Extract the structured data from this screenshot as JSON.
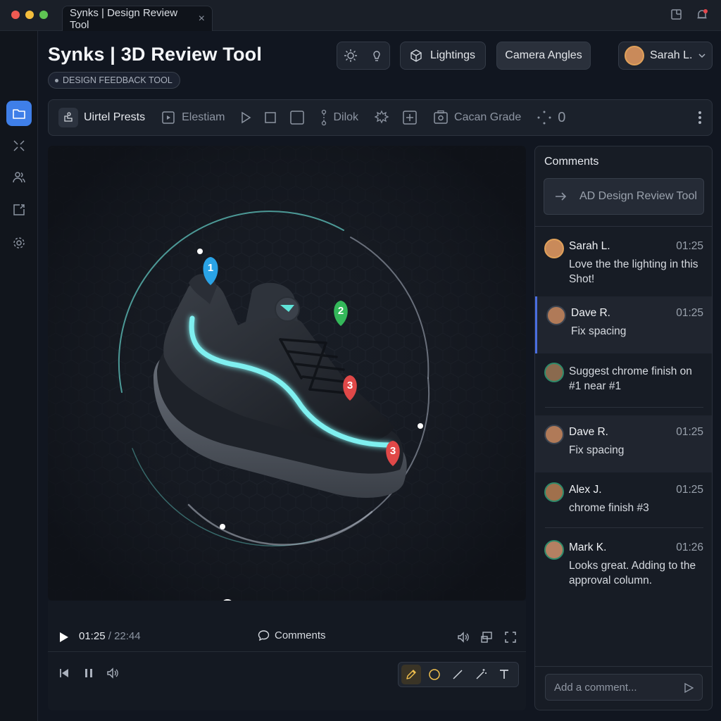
{
  "window": {
    "tab_title": "Synks | Design Review Tool",
    "tab_close": "×"
  },
  "header": {
    "title": "Synks | 3D Review Tool",
    "tag": "DESIGN FEEDBACK TOOL",
    "lightings_label": "Lightings",
    "camera_angles_label": "Camera Angles",
    "user_name": "Sarah L."
  },
  "toolbar": {
    "items": [
      "Uirtel Prests",
      "Elestiam",
      "Dilok",
      "Cacan Grade",
      "0"
    ]
  },
  "viewport": {
    "pins": [
      "1",
      "2",
      "3"
    ],
    "pin_colors": [
      "#2aa3e6",
      "#34b85a",
      "#e04848"
    ],
    "progress": 0.37,
    "buffered": 0.57
  },
  "player": {
    "current_time": "01:25",
    "separator": " / ",
    "total_time": "22:44",
    "comments_label": "Comments"
  },
  "comments_panel": {
    "title": "Comments",
    "action_label": "AD Design Review Tool",
    "items": [
      {
        "name": "Sarah L.",
        "time": "01:25",
        "text": "Love the the lighting in this Shot!",
        "avatar": "#c98a5a"
      },
      {
        "name": "Dave R.",
        "time": "01:25",
        "text": "Fix spacing",
        "avatar": "#b07a58"
      },
      {
        "name": "",
        "time": "",
        "text": "Suggest chrome finish on #1 near #1",
        "avatar": "#8a6a4e"
      },
      {
        "name": "Dave R.",
        "time": "01:25",
        "text": "Fix spacing",
        "avatar": "#b07a58"
      },
      {
        "name": "Alex J.",
        "time": "01:25",
        "text": "chrome finish #3",
        "avatar": "#a0704c"
      },
      {
        "name": "Mark K.",
        "time": "01:26",
        "text": "Looks great. Adding to the approval column.",
        "avatar": "#b58062"
      }
    ],
    "add_placeholder": "Add a comment..."
  },
  "colors": {
    "accent": "#3f7fe8",
    "glow": "#7ff0f0",
    "progress": "#3bb3a8"
  }
}
